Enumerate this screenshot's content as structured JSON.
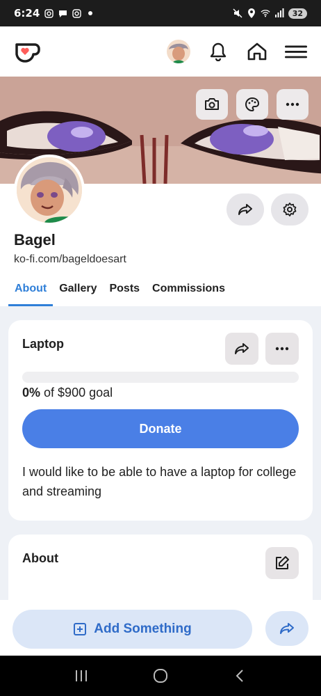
{
  "status_bar": {
    "time": "6:24",
    "battery": "32"
  },
  "banner": {
    "actions": [
      "camera-icon",
      "palette-icon",
      "more-icon"
    ]
  },
  "profile": {
    "name": "Bagel",
    "url": "ko-fi.com/bageldoesart"
  },
  "tabs": [
    {
      "label": "About",
      "active": true
    },
    {
      "label": "Gallery",
      "active": false
    },
    {
      "label": "Posts",
      "active": false
    },
    {
      "label": "Commissions",
      "active": false
    }
  ],
  "goal": {
    "title": "Laptop",
    "percent_label": "0%",
    "goal_suffix": "of $900 goal",
    "progress": 0,
    "donate_label": "Donate",
    "description": "I would like to be able to have a laptop for college and streaming"
  },
  "about": {
    "title": "About"
  },
  "bottom": {
    "add_label": "Add Something"
  },
  "colors": {
    "accent": "#2f7fd8",
    "donate": "#4a7fe6",
    "kofi_red": "#ff5e5b"
  }
}
